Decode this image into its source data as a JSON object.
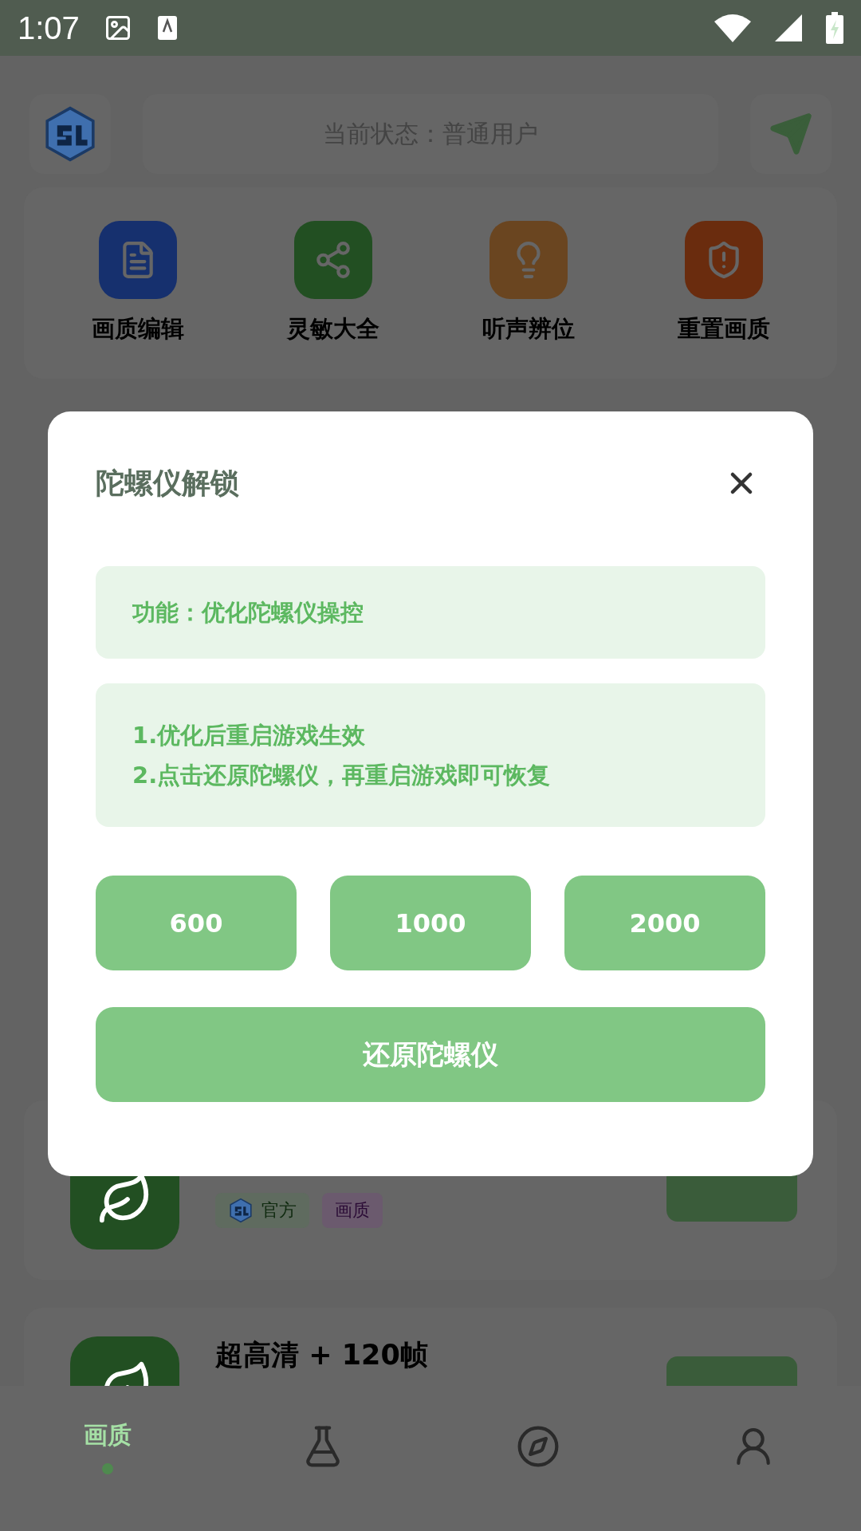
{
  "status_bar": {
    "time": "1:07"
  },
  "header": {
    "status_text": "当前状态：普通用户"
  },
  "features": [
    {
      "label": "画质编辑",
      "color": "#16306e"
    },
    {
      "label": "灵敏大全",
      "color": "#224f22"
    },
    {
      "label": "听声辨位",
      "color": "#6a4520"
    },
    {
      "label": "重置画质",
      "color": "#6a2c0e"
    }
  ],
  "cards": [
    {
      "tags": [
        {
          "label": "官方",
          "color": "#5f6b5f"
        },
        {
          "label": "画质",
          "color": "#6b5a6e"
        }
      ]
    },
    {
      "title": "超高清 + 120帧"
    }
  ],
  "dialog": {
    "title": "陀螺仪解锁",
    "function_text": "功能：优化陀螺仪操控",
    "notes": [
      "1.优化后重启游戏生效",
      "2.点击还原陀螺仪，再重启游戏即可恢复"
    ],
    "options": [
      "600",
      "1000",
      "2000"
    ],
    "restore_button": "还原陀螺仪"
  },
  "bottom_nav": [
    {
      "kind": "text",
      "label": "画质",
      "selected": true
    },
    {
      "kind": "lab",
      "selected": false
    },
    {
      "kind": "explore",
      "selected": false
    },
    {
      "kind": "profile",
      "selected": false
    }
  ]
}
